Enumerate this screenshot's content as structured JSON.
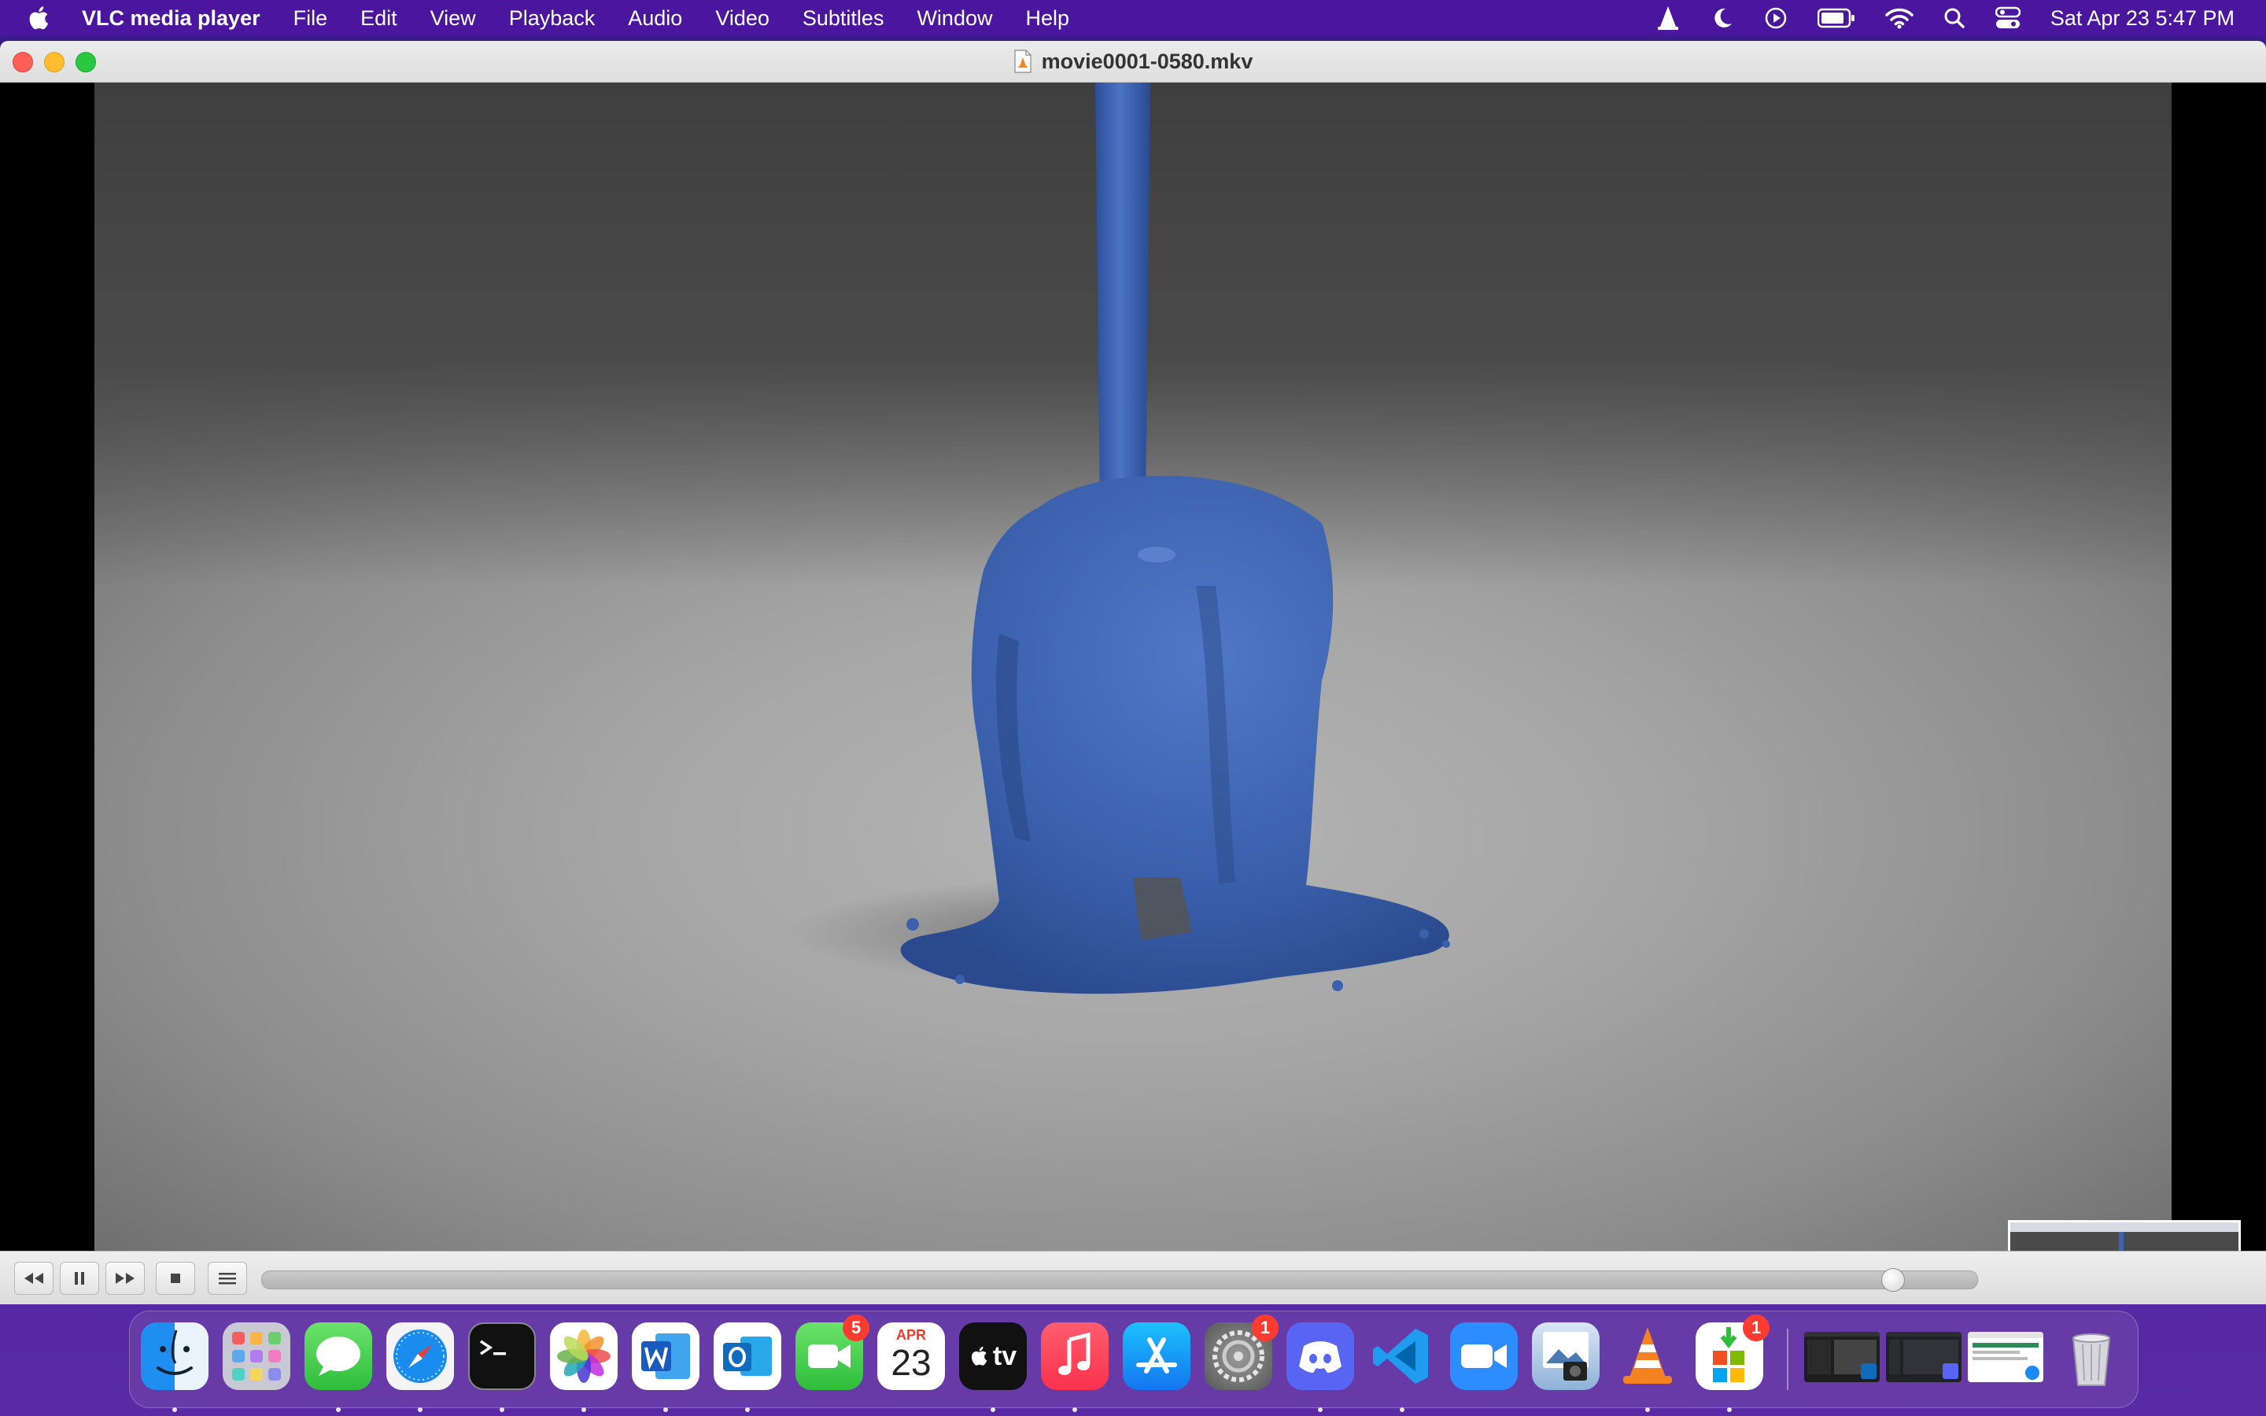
{
  "menubar": {
    "app_name": "VLC media player",
    "items": [
      "File",
      "Edit",
      "View",
      "Playback",
      "Audio",
      "Video",
      "Subtitles",
      "Window",
      "Help"
    ],
    "status_icons": [
      "vlc-cone-icon",
      "moon-icon",
      "play-circle-icon",
      "battery-icon",
      "wifi-icon",
      "search-icon",
      "control-center-icon"
    ],
    "clock": "Sat Apr 23  5:47 PM"
  },
  "window": {
    "title": "movie0001-0580.mkv"
  },
  "playback": {
    "state": "paused",
    "position_fraction": 0.957,
    "buttons": [
      "rewind-icon",
      "pause-icon",
      "fast-forward-icon",
      "stop-icon",
      "playlist-icon"
    ]
  },
  "dock": {
    "apps": [
      {
        "name": "Finder",
        "icon": "finder-icon",
        "running": true
      },
      {
        "name": "Launchpad",
        "icon": "launchpad-icon",
        "running": false
      },
      {
        "name": "Messages",
        "icon": "messages-icon",
        "running": true
      },
      {
        "name": "Safari",
        "icon": "safari-icon",
        "running": true
      },
      {
        "name": "Terminal",
        "icon": "terminal-icon",
        "running": true
      },
      {
        "name": "Photos",
        "icon": "photos-icon",
        "running": true
      },
      {
        "name": "Microsoft Word",
        "icon": "word-icon",
        "running": true
      },
      {
        "name": "Microsoft Outlook",
        "icon": "outlook-icon",
        "running": true
      },
      {
        "name": "FaceTime",
        "icon": "facetime-icon",
        "running": false,
        "badge": "5"
      },
      {
        "name": "Calendar",
        "icon": "calendar-icon",
        "running": false,
        "month": "APR",
        "day": "23"
      },
      {
        "name": "Apple TV",
        "icon": "tv-icon",
        "running": true,
        "label": "tv"
      },
      {
        "name": "Music",
        "icon": "music-icon",
        "running": true
      },
      {
        "name": "App Store",
        "icon": "app-store-icon",
        "running": false
      },
      {
        "name": "System Preferences",
        "icon": "system-preferences-icon",
        "running": false,
        "badge": "1"
      },
      {
        "name": "Discord",
        "icon": "discord-icon",
        "running": true
      },
      {
        "name": "Visual Studio Code",
        "icon": "vscode-icon",
        "running": true
      },
      {
        "name": "Zoom",
        "icon": "zoom-icon",
        "running": false
      },
      {
        "name": "Preview",
        "icon": "preview-icon",
        "running": false
      },
      {
        "name": "VLC",
        "icon": "vlc-icon",
        "running": true
      },
      {
        "name": "Microsoft AutoUpdate",
        "icon": "ms-autoupdate-icon",
        "running": true,
        "badge": "1"
      }
    ],
    "minimized": [
      "minimized-window-outlook",
      "minimized-window-discord",
      "minimized-window-safari"
    ],
    "trash": "trash-icon"
  },
  "colors": {
    "menubar": "#4a169e",
    "liquid_blue": "#3f63b0",
    "close": "#fe5f57",
    "minimize": "#febc2e",
    "zoom": "#28c840"
  }
}
